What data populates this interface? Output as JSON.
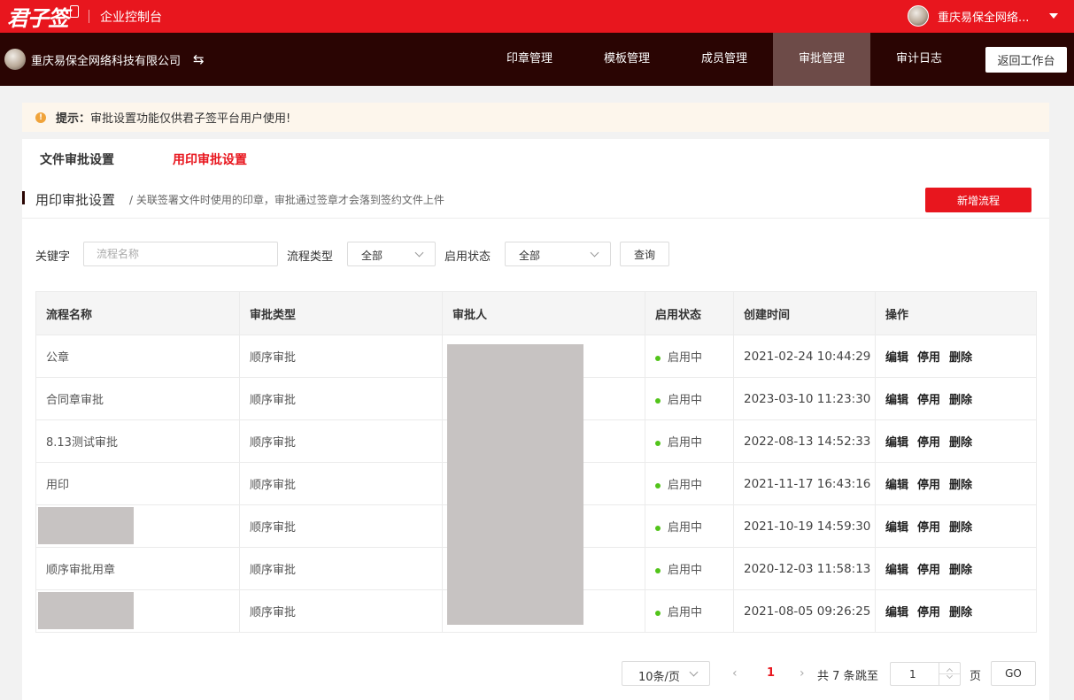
{
  "header": {
    "logo_text": "君子签",
    "title": "企业控制台",
    "user_name": "重庆易保全网络..."
  },
  "nav": {
    "company_name": "重庆易保全网络科技有限公司",
    "switch_icon": "swap-icon",
    "items": [
      {
        "label": "印章管理",
        "active": false
      },
      {
        "label": "模板管理",
        "active": false
      },
      {
        "label": "成员管理",
        "active": false
      },
      {
        "label": "审批管理",
        "active": true
      },
      {
        "label": "审计日志",
        "active": false
      }
    ],
    "back_label": "返回工作台"
  },
  "notice": {
    "label": "提示：",
    "text": "审批设置功能仅供君子签平台用户使用!"
  },
  "tabs": [
    {
      "label": "文件审批设置",
      "active": false
    },
    {
      "label": "用印审批设置",
      "active": true
    }
  ],
  "section": {
    "title": "用印审批设置",
    "desc": "/ 关联签署文件时使用的印章，审批通过签章才会落到签约文件上件",
    "add_label": "新增流程"
  },
  "filters": {
    "keyword_label": "关键字",
    "keyword_placeholder": "流程名称",
    "type_label": "流程类型",
    "type_value": "全部",
    "status_label": "启用状态",
    "status_value": "全部",
    "query_label": "查询"
  },
  "table": {
    "columns": [
      "流程名称",
      "审批类型",
      "审批人",
      "启用状态",
      "创建时间",
      "操作"
    ],
    "actions": [
      "编辑",
      "停用",
      "删除"
    ],
    "rows": [
      {
        "name": "公章",
        "type": "顺序审批",
        "status": "启用中",
        "time": "2021-02-24 10:44:29",
        "redacted": false
      },
      {
        "name": "合同章审批",
        "type": "顺序审批",
        "status": "启用中",
        "time": "2023-03-10 11:23:30",
        "redacted": false
      },
      {
        "name": "8.13测试审批",
        "type": "顺序审批",
        "status": "启用中",
        "time": "2022-08-13 14:52:33",
        "redacted": false
      },
      {
        "name": "用印",
        "type": "顺序审批",
        "status": "启用中",
        "time": "2021-11-17 16:43:16",
        "redacted": false
      },
      {
        "name": "",
        "type": "顺序审批",
        "status": "启用中",
        "time": "2021-10-19 14:59:30",
        "redacted": true
      },
      {
        "name": "顺序审批用章",
        "type": "顺序审批",
        "status": "启用中",
        "time": "2020-12-03 11:58:13",
        "redacted": false
      },
      {
        "name": "",
        "type": "顺序审批",
        "status": "启用中",
        "time": "2021-08-05 09:26:25",
        "redacted": true
      }
    ]
  },
  "pagination": {
    "page_size": "10条/页",
    "prev": "‹",
    "current": "1",
    "next": "›",
    "total_text": "共 7 条",
    "jump_label": "跳至",
    "jump_value": "1",
    "page_unit": "页",
    "go_label": "GO"
  },
  "colors": {
    "brand_red": "#e8161e",
    "nav_dark": "#2a0503",
    "nav_active": "#6d4b48",
    "status_green": "#52c41a",
    "warning": "#f0a33a"
  }
}
